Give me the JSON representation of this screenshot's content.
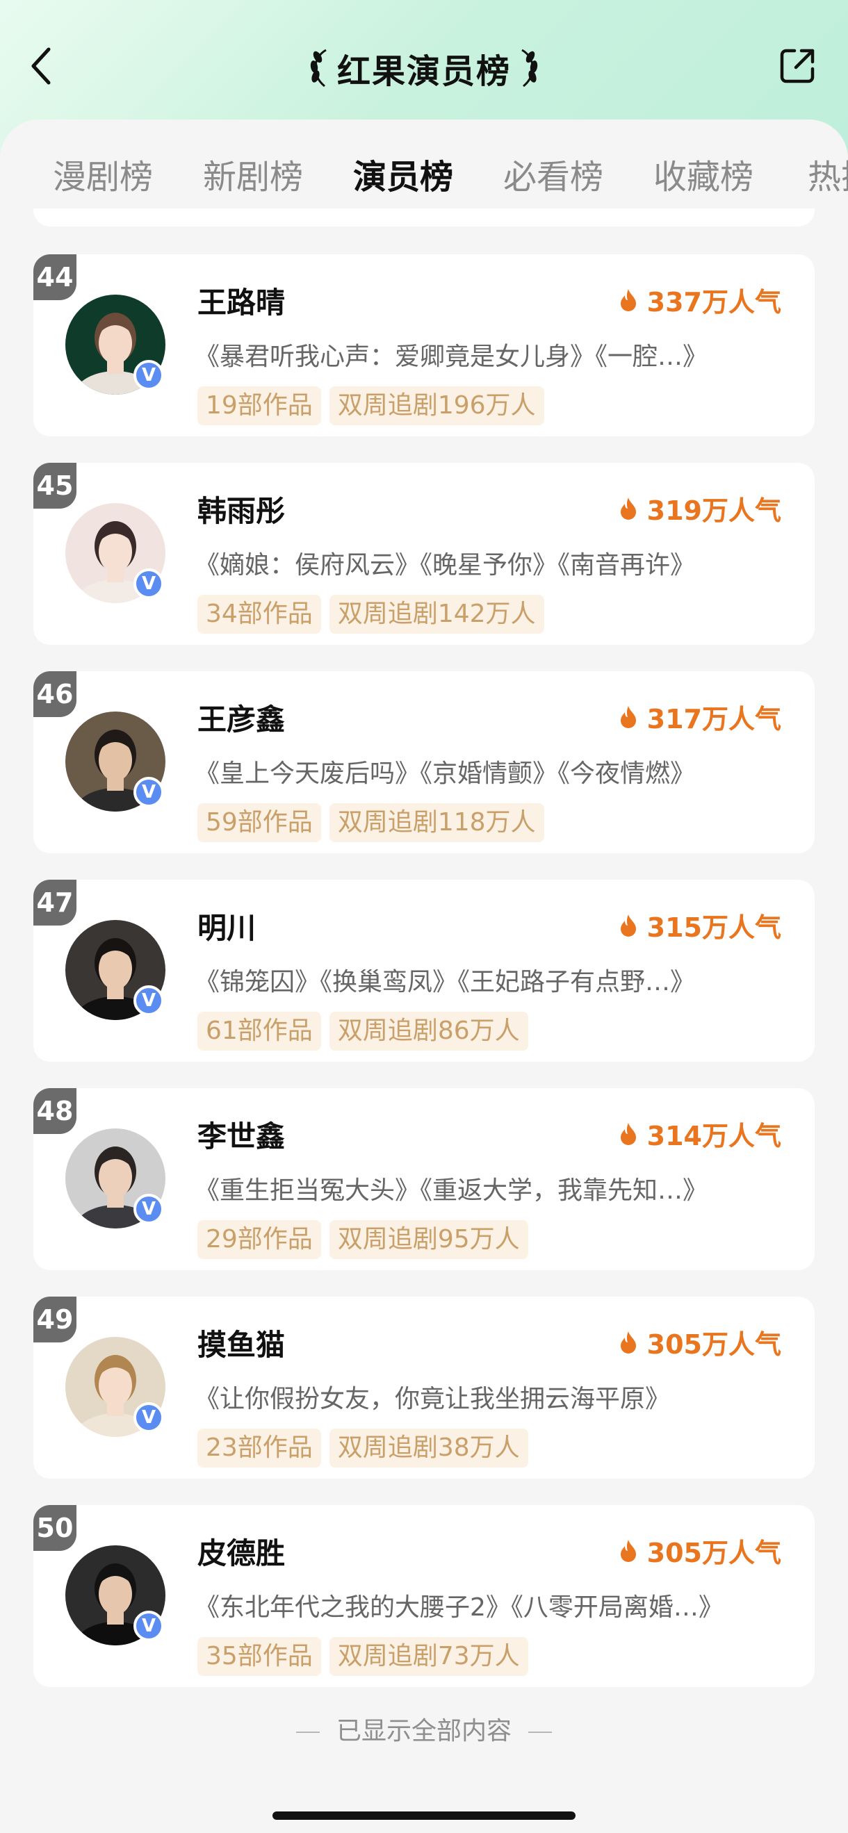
{
  "header": {
    "title": "红果演员榜",
    "back_icon": "chevron-left-icon",
    "share_icon": "share-icon"
  },
  "tabs": [
    {
      "label": "漫剧榜",
      "active": false
    },
    {
      "label": "新剧榜",
      "active": false
    },
    {
      "label": "演员榜",
      "active": true
    },
    {
      "label": "必看榜",
      "active": false
    },
    {
      "label": "收藏榜",
      "active": false
    },
    {
      "label": "热搜",
      "active": false
    }
  ],
  "actors": [
    {
      "rank": "44",
      "name": "王路晴",
      "popularity": "337万人气",
      "works": "《暴君听我心声：爱卿竟是女儿身》《一腔…》",
      "count": "19部作品",
      "followers": "双周追剧196万人",
      "badge": "V"
    },
    {
      "rank": "45",
      "name": "韩雨彤",
      "popularity": "319万人气",
      "works": "《嫡娘：侯府风云》《晚星予你》《南音再许》",
      "count": "34部作品",
      "followers": "双周追剧142万人",
      "badge": "V"
    },
    {
      "rank": "46",
      "name": "王彦鑫",
      "popularity": "317万人气",
      "works": "《皇上今天废后吗》《京婚情颤》《今夜情燃》",
      "count": "59部作品",
      "followers": "双周追剧118万人",
      "badge": "V"
    },
    {
      "rank": "47",
      "name": "明川",
      "popularity": "315万人气",
      "works": "《锦笼囚》《换巢鸾凤》《王妃路子有点野…》",
      "count": "61部作品",
      "followers": "双周追剧86万人",
      "badge": "V"
    },
    {
      "rank": "48",
      "name": "李世鑫",
      "popularity": "314万人气",
      "works": "《重生拒当冤大头》《重返大学，我靠先知…》",
      "count": "29部作品",
      "followers": "双周追剧95万人",
      "badge": "V"
    },
    {
      "rank": "49",
      "name": "摸鱼猫",
      "popularity": "305万人气",
      "works": "《让你假扮女友，你竟让我坐拥云海平原》",
      "count": "23部作品",
      "followers": "双周追剧38万人",
      "badge": "V"
    },
    {
      "rank": "50",
      "name": "皮德胜",
      "popularity": "305万人气",
      "works": "《东北年代之我的大腰子2》《八零开局离婚…》",
      "count": "35部作品",
      "followers": "双周追剧73万人",
      "badge": "V"
    }
  ],
  "footer": {
    "text": "已显示全部内容"
  },
  "colors": {
    "accent": "#e9751f",
    "tag_bg": "#fbf1e4",
    "tag_text": "#c9a06a",
    "rank_bg": "#6b6b6b",
    "badge": "#5b8cf2"
  }
}
